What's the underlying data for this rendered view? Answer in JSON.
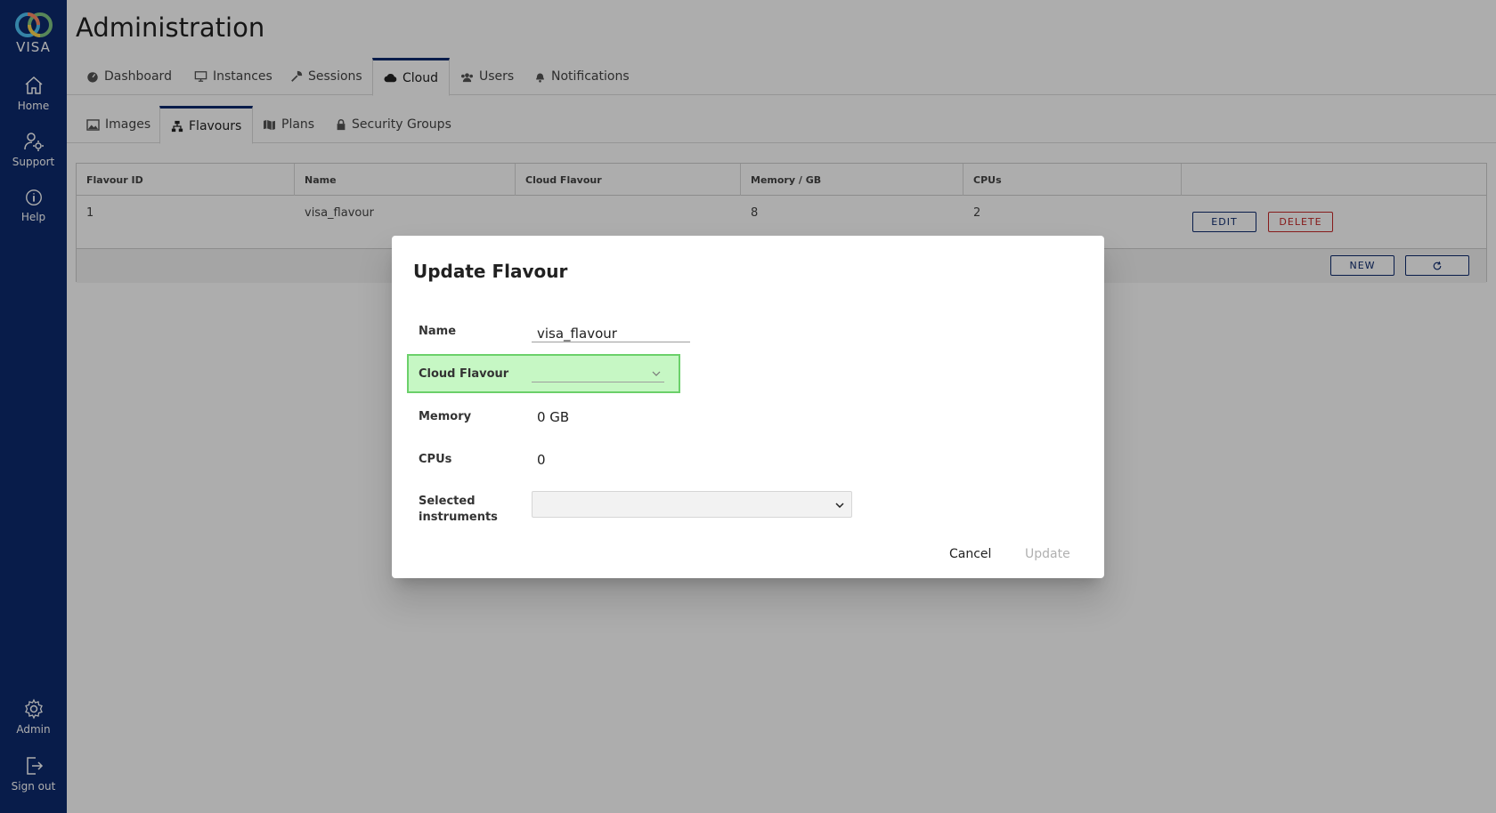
{
  "app": {
    "logo_text": "VISA"
  },
  "sidebar": {
    "items": [
      {
        "label": "Home",
        "icon": "home-icon"
      },
      {
        "label": "Support",
        "icon": "support-icon"
      },
      {
        "label": "Help",
        "icon": "info-icon"
      },
      {
        "label": "Admin",
        "icon": "gear-icon"
      },
      {
        "label": "Sign out",
        "icon": "sign-out-icon"
      }
    ]
  },
  "header": {
    "title": "Administration"
  },
  "main_tabs": [
    {
      "label": "Dashboard",
      "icon": "dashboard-icon"
    },
    {
      "label": "Instances",
      "icon": "monitor-icon"
    },
    {
      "label": "Sessions",
      "icon": "wrench-icon"
    },
    {
      "label": "Cloud",
      "icon": "cloud-icon",
      "active": true
    },
    {
      "label": "Users",
      "icon": "users-icon"
    },
    {
      "label": "Notifications",
      "icon": "bell-icon"
    }
  ],
  "sub_tabs": [
    {
      "label": "Images",
      "icon": "image-icon"
    },
    {
      "label": "Flavours",
      "icon": "sitemap-icon",
      "active": true
    },
    {
      "label": "Plans",
      "icon": "map-icon"
    },
    {
      "label": "Security Groups",
      "icon": "lock-icon"
    }
  ],
  "table": {
    "columns": [
      "Flavour ID",
      "Name",
      "Cloud Flavour",
      "Memory / GB",
      "CPUs",
      ""
    ],
    "rows": [
      {
        "id": "1",
        "name": "visa_flavour",
        "cloud_flavour": "",
        "memory": "8",
        "cpus": "2"
      }
    ],
    "edit_label": "EDIT",
    "delete_label": "DELETE",
    "new_label": "NEW",
    "refresh_icon": "refresh-icon"
  },
  "dialog": {
    "title": "Update Flavour",
    "name_label": "Name",
    "name_value": "visa_flavour",
    "cloud_flavour_label": "Cloud Flavour",
    "cloud_flavour_value": "",
    "memory_label": "Memory",
    "memory_value": "0 GB",
    "cpus_label": "CPUs",
    "cpus_value": "0",
    "instruments_label": "Selected instruments",
    "instruments_value": "",
    "cancel_label": "Cancel",
    "update_label": "Update"
  },
  "colors": {
    "sidebar_bg": "#0d2a6e",
    "highlight_bg": "#c6f7c4",
    "highlight_border": "#6bd06a",
    "delete_red": "#c62828",
    "disabled_text": "#b0b0b0"
  }
}
